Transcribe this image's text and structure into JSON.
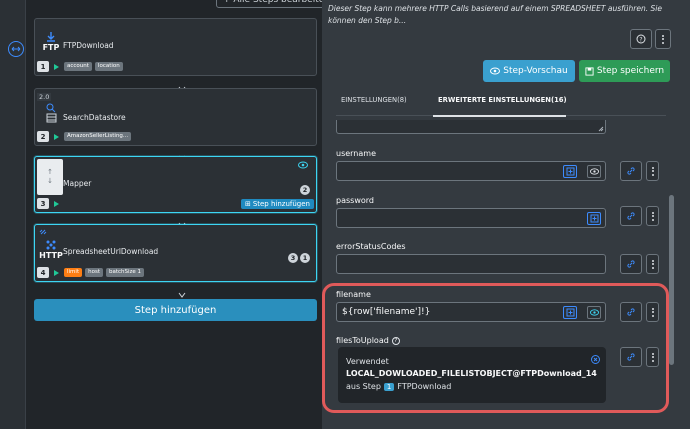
{
  "top_button": "+ Alle Steps bearbeiten",
  "steps": [
    {
      "num": "1",
      "icon_label": "FTP",
      "title": "FTPDownload",
      "chips": [
        "account",
        "location"
      ]
    },
    {
      "num": "2",
      "version": "2.0",
      "title": "SearchDatastore",
      "chips": [
        "AmazonSellerListing..."
      ]
    },
    {
      "num": "3",
      "title": "Mapper",
      "count": "2",
      "add_label": "Step hinzufügen"
    },
    {
      "num": "4",
      "icon_label": "HTTP",
      "title": "SpreadsheetUrlDownload",
      "counts": [
        "3",
        "1"
      ],
      "chips": [
        "limit",
        "host",
        "batchSize 1"
      ]
    }
  ],
  "add_step_label": "Step hinzufügen",
  "description": "Dieser Step kann mehrere HTTP Calls basierend auf einem SPREADSHEET ausführen. Sie können den Step b...",
  "preview_label": "Step-Vorschau",
  "save_label": "Step speichern",
  "tabs": [
    {
      "label": "EINSTELLUNGEN(8)",
      "active": false
    },
    {
      "label": "ERWEITERTE EINSTELLUNGEN(16)",
      "active": true
    }
  ],
  "fields": {
    "username": {
      "label": "username",
      "value": ""
    },
    "password": {
      "label": "password",
      "value": ""
    },
    "errorStatusCodes": {
      "label": "errorStatusCodes",
      "value": ""
    },
    "filename": {
      "label": "filename",
      "value": "${row['filename']!}"
    },
    "filesToUpload": {
      "label": "filesToUpload",
      "used_label": "Verwendet",
      "used_value": "LOCAL_DOWLOADED_FILELISTOBJECT@FTPDownload_14",
      "from_step_prefix": "aus Step",
      "from_step_num": "1",
      "from_step_name": "FTPDownload"
    }
  },
  "colors": {
    "accent": "#3aa0cf",
    "save": "#2e9b57",
    "highlight": "#e05a5a"
  }
}
